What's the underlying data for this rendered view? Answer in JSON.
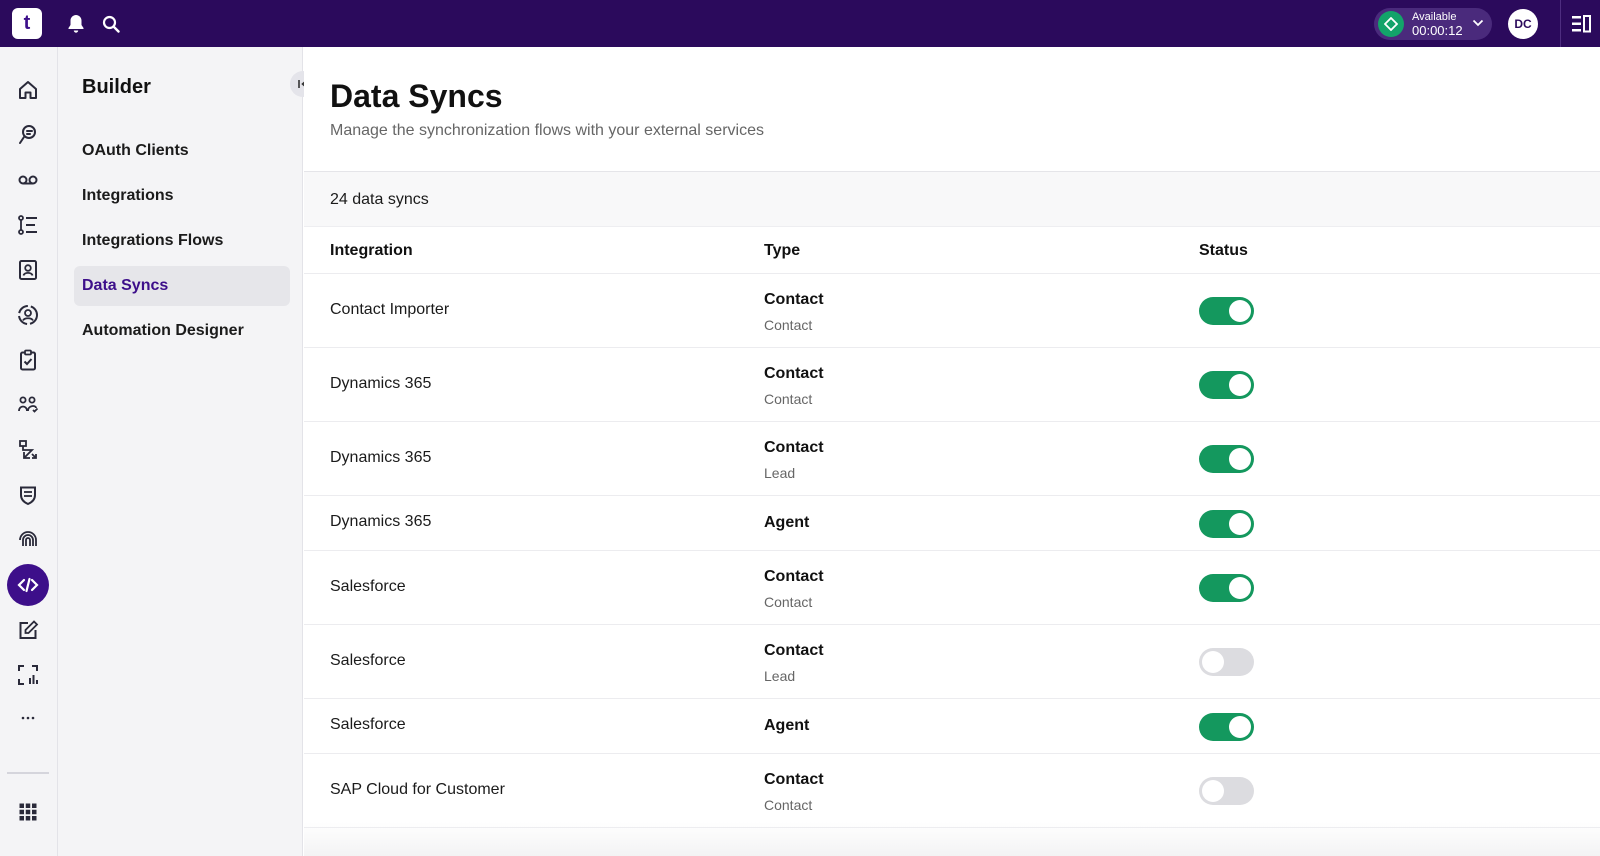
{
  "app": {
    "logo_text": "t"
  },
  "topbar": {
    "status_label": "Available",
    "status_timer": "00:00:12",
    "avatar_initials": "DC"
  },
  "subnav": {
    "title": "Builder",
    "items": [
      {
        "label": "OAuth Clients"
      },
      {
        "label": "Integrations"
      },
      {
        "label": "Integrations Flows"
      },
      {
        "label": "Data Syncs",
        "active": true
      },
      {
        "label": "Automation Designer"
      }
    ]
  },
  "page": {
    "title": "Data Syncs",
    "subtitle": "Manage the synchronization flows with your external services",
    "count": "24 data syncs"
  },
  "table": {
    "headers": {
      "integration": "Integration",
      "type": "Type",
      "status": "Status"
    },
    "rows": [
      {
        "integration": "Contact Importer",
        "type": "Contact",
        "subtype": "Contact",
        "enabled": true
      },
      {
        "integration": "Dynamics 365",
        "type": "Contact",
        "subtype": "Contact",
        "enabled": true
      },
      {
        "integration": "Dynamics 365",
        "type": "Contact",
        "subtype": "Lead",
        "enabled": true
      },
      {
        "integration": "Dynamics 365",
        "type": "Agent",
        "subtype": "",
        "enabled": true
      },
      {
        "integration": "Salesforce",
        "type": "Contact",
        "subtype": "Contact",
        "enabled": true
      },
      {
        "integration": "Salesforce",
        "type": "Contact",
        "subtype": "Lead",
        "enabled": false
      },
      {
        "integration": "Salesforce",
        "type": "Agent",
        "subtype": "",
        "enabled": true
      },
      {
        "integration": "SAP Cloud for Customer",
        "type": "Contact",
        "subtype": "Contact",
        "enabled": false
      }
    ]
  },
  "colors": {
    "topbar": "#2b0a5c",
    "accent": "#3d0f8a",
    "toggle_on": "#14985e",
    "toggle_off": "#dcdce0"
  }
}
